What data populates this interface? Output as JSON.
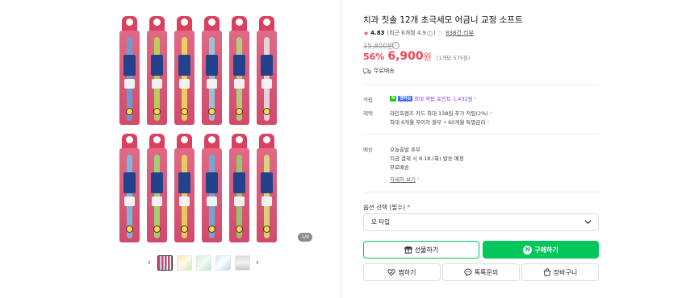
{
  "product": {
    "title": "치과 칫솔 12개 초극세모 어금니 교정 소프트",
    "rating": "4.83",
    "rating_sub": "(최근 6개월 4.9",
    "rating_sub_end": ")",
    "review_count": "838건 리뷰",
    "original_price": "15,800원",
    "discount": "56%",
    "price": "6,900",
    "won": "원",
    "unit_price": "(1개당 575원)",
    "shipping": "무료배송"
  },
  "gallery": {
    "page_counter": "1/9",
    "thumbnail_count": 5,
    "brush_handle_colors": [
      "#5aa6e0",
      "#b7e04f",
      "#f2e25a",
      "#8ed3e8",
      "#a8e07a",
      "#e8e8e8",
      "#6fc4ef",
      "#9be36e",
      "#e6df5a",
      "#5fb2e6",
      "#89d86a",
      "#d9e87a"
    ]
  },
  "benefits": {
    "points_label": "적립",
    "points_badge_n": "N",
    "points_badge_pay": "멤버십",
    "points_text": "최대 적립 포인트 1,432원",
    "perks_label": "혜택",
    "perk_1": "라인프렌즈 카드 최대 138원 추가 적립(2%)",
    "perk_2": "최대 6개월 무이자 할부 • 60개월 특별금리"
  },
  "delivery": {
    "label": "배송",
    "line_1": "오늘출발 휴무",
    "line_2": "지금 결제 시 8.18.(화) 발송 예정",
    "line_3": "무료배송",
    "detail_link": "자세히 보기"
  },
  "options": {
    "label": "옵션 선택 (필수)",
    "required_mark": "*",
    "selected": "모 타입"
  },
  "actions": {
    "gift": "선물하기",
    "buy": "구매하기",
    "buy_badge": "N",
    "wish": "찜하기",
    "talk": "톡톡문의",
    "cart": "장바구니"
  },
  "colors": {
    "brand_green": "#03c75a",
    "price_red": "#f04452",
    "point_purple": "#7b3ef2"
  }
}
